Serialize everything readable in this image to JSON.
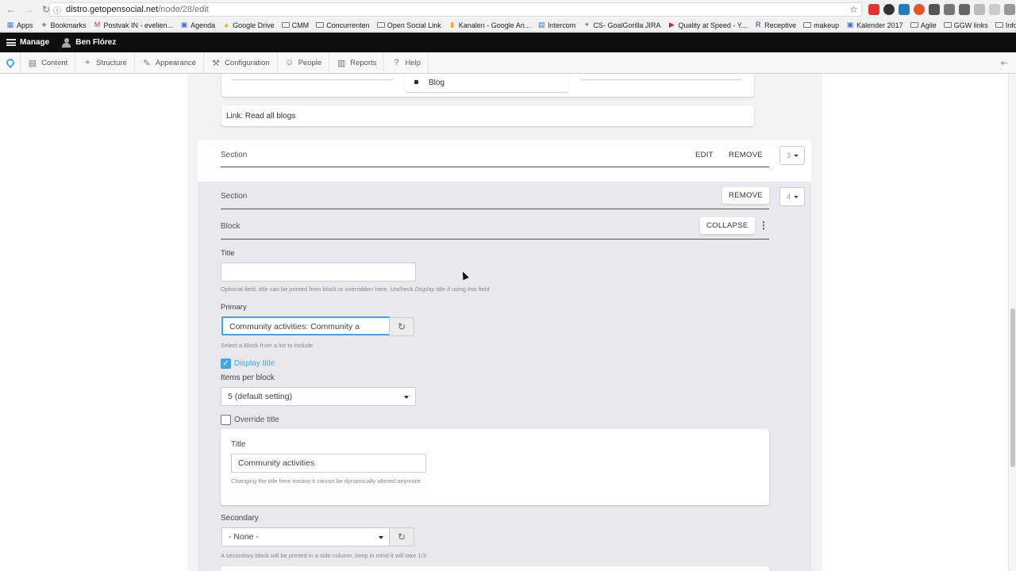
{
  "browser": {
    "url_host": "distro.getopensocial.net",
    "url_path": "/node/28/edit",
    "bookmarks": [
      {
        "label": "Apps",
        "icon": "apps-grid-icon"
      },
      {
        "label": "Bookmarks",
        "icon": "star-icon"
      },
      {
        "label": "Postvak IN - evelien...",
        "icon": "gmail-icon"
      },
      {
        "label": "Agenda",
        "icon": "calendar-icon"
      },
      {
        "label": "Google Drive",
        "icon": "drive-icon"
      },
      {
        "label": "CMM",
        "icon": "folder-icon"
      },
      {
        "label": "Concurrenten",
        "icon": "folder-icon"
      },
      {
        "label": "Open Social Link",
        "icon": "folder-icon"
      },
      {
        "label": "Kanalen - Google An...",
        "icon": "analytics-icon"
      },
      {
        "label": "Intercom",
        "icon": "intercom-icon"
      },
      {
        "label": "CS- GoalGorilla JIRA",
        "icon": "jira-icon"
      },
      {
        "label": "Quality at Speed - Y...",
        "icon": "youtube-icon"
      },
      {
        "label": "Receptive",
        "icon": "receptive-icon"
      },
      {
        "label": "makeup",
        "icon": "folder-icon"
      },
      {
        "label": "Kalender 2017",
        "icon": "calendar-icon"
      },
      {
        "label": "Agile",
        "icon": "folder-icon"
      },
      {
        "label": "GGW links",
        "icon": "folder-icon"
      },
      {
        "label": "Info",
        "icon": "folder-icon"
      }
    ]
  },
  "toolbar": {
    "manage": "Manage",
    "user": "Ben Flórez",
    "tray": [
      {
        "label": "Content",
        "icon": "file-icon",
        "glyph": "▤"
      },
      {
        "label": "Structure",
        "icon": "structure-icon",
        "glyph": "⌖"
      },
      {
        "label": "Appearance",
        "icon": "brush-icon",
        "glyph": "✎"
      },
      {
        "label": "Configuration",
        "icon": "wrench-icon",
        "glyph": "⚒"
      },
      {
        "label": "People",
        "icon": "people-icon",
        "glyph": "☺"
      },
      {
        "label": "Reports",
        "icon": "reports-icon",
        "glyph": "▥"
      },
      {
        "label": "Help",
        "icon": "help-icon",
        "glyph": "?"
      }
    ]
  },
  "top_card": {
    "blog_item": "Blog",
    "link_text": "Link: Read all blogs"
  },
  "section3": {
    "label": "Section",
    "edit": "EDIT",
    "remove": "REMOVE",
    "weight": "3"
  },
  "section4": {
    "label": "Section",
    "remove": "REMOVE",
    "weight": "4"
  },
  "block": {
    "label": "Block",
    "collapse": "COLLAPSE",
    "title_label": "Title",
    "title_value": "",
    "title_help_pre": "Optional field, title can be printed from block or overridden here. Uncheck ",
    "title_help_em": "Display title",
    "title_help_post": " if using this field",
    "primary_label": "Primary",
    "primary_value": "Community activities: Community a",
    "primary_help": "Select a Block from a list to include",
    "display_title_label": "Display title",
    "display_title_checked": true,
    "items_label": "Items per block",
    "items_value": "5 (default setting)",
    "override_label": "Override title",
    "override_checked": false,
    "override_title_label": "Title",
    "override_title_value": "Community activities",
    "override_help": "Changing the title here means it cannot be dynamically altered anymore.",
    "secondary_label": "Secondary",
    "secondary_value": "- None -",
    "secondary_help": "A secondary block will be printed in a side column, keep in mind it will take 1/3"
  },
  "colors": {
    "accent": "#4aa3df",
    "toolbar_bg": "#0f0f0f"
  }
}
